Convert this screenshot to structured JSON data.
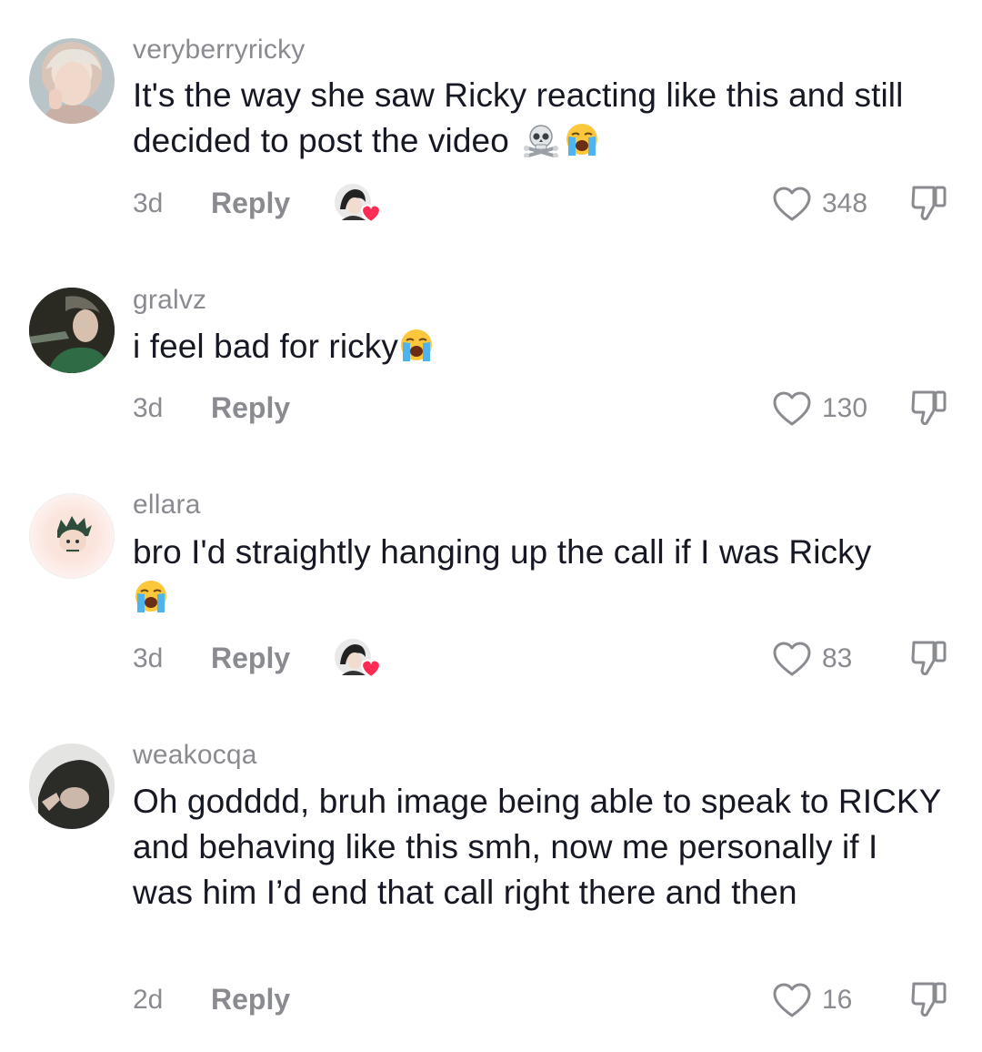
{
  "comments": [
    {
      "username": "veryberryricky",
      "text": "It's the way she saw Ricky reacting like this and still decided to post the video",
      "emojis": [
        "skull-crossbones-emoji",
        "loudly-crying-emoji"
      ],
      "time": "3d",
      "reply_label": "Reply",
      "liked_by_creator": true,
      "likes": "348"
    },
    {
      "username": "gralvz",
      "text": "i feel bad for ricky",
      "emojis": [
        "loudly-crying-emoji"
      ],
      "time": "3d",
      "reply_label": "Reply",
      "liked_by_creator": false,
      "likes": "130"
    },
    {
      "username": "ellara",
      "text": "bro I'd straightly hanging up the call if I was Ricky",
      "emojis": [
        "loudly-crying-emoji"
      ],
      "time": "3d",
      "reply_label": "Reply",
      "liked_by_creator": true,
      "likes": "83"
    },
    {
      "username": "weakocqa",
      "text": "Oh godddd, bruh image being able to speak to RICKY and behaving like this smh, now me personally if I was him I’d end that call right there and then",
      "emojis": [],
      "time": "2d",
      "reply_label": "Reply",
      "liked_by_creator": false,
      "likes": "16"
    }
  ],
  "colors": {
    "text": "#161823",
    "secondary": "#8a8b91",
    "creator_heart": "#fe2c55"
  },
  "icons": [
    "heart-outline-icon",
    "dislike-icon",
    "creator-liked-badge-icon"
  ]
}
